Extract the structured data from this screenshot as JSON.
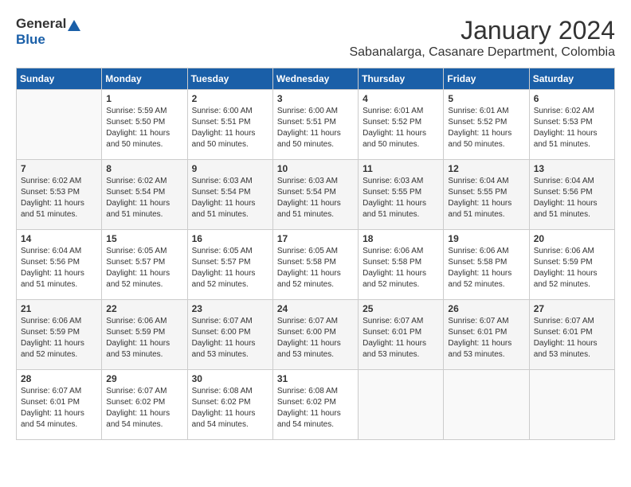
{
  "header": {
    "logo_general": "General",
    "logo_blue": "Blue",
    "title": "January 2024",
    "subtitle": "Sabanalarga, Casanare Department, Colombia"
  },
  "weekdays": [
    "Sunday",
    "Monday",
    "Tuesday",
    "Wednesday",
    "Thursday",
    "Friday",
    "Saturday"
  ],
  "weeks": [
    [
      {
        "day": "",
        "sunrise": "",
        "sunset": "",
        "daylight": ""
      },
      {
        "day": "1",
        "sunrise": "Sunrise: 5:59 AM",
        "sunset": "Sunset: 5:50 PM",
        "daylight": "Daylight: 11 hours and 50 minutes."
      },
      {
        "day": "2",
        "sunrise": "Sunrise: 6:00 AM",
        "sunset": "Sunset: 5:51 PM",
        "daylight": "Daylight: 11 hours and 50 minutes."
      },
      {
        "day": "3",
        "sunrise": "Sunrise: 6:00 AM",
        "sunset": "Sunset: 5:51 PM",
        "daylight": "Daylight: 11 hours and 50 minutes."
      },
      {
        "day": "4",
        "sunrise": "Sunrise: 6:01 AM",
        "sunset": "Sunset: 5:52 PM",
        "daylight": "Daylight: 11 hours and 50 minutes."
      },
      {
        "day": "5",
        "sunrise": "Sunrise: 6:01 AM",
        "sunset": "Sunset: 5:52 PM",
        "daylight": "Daylight: 11 hours and 50 minutes."
      },
      {
        "day": "6",
        "sunrise": "Sunrise: 6:02 AM",
        "sunset": "Sunset: 5:53 PM",
        "daylight": "Daylight: 11 hours and 51 minutes."
      }
    ],
    [
      {
        "day": "7",
        "sunrise": "Sunrise: 6:02 AM",
        "sunset": "Sunset: 5:53 PM",
        "daylight": "Daylight: 11 hours and 51 minutes."
      },
      {
        "day": "8",
        "sunrise": "Sunrise: 6:02 AM",
        "sunset": "Sunset: 5:54 PM",
        "daylight": "Daylight: 11 hours and 51 minutes."
      },
      {
        "day": "9",
        "sunrise": "Sunrise: 6:03 AM",
        "sunset": "Sunset: 5:54 PM",
        "daylight": "Daylight: 11 hours and 51 minutes."
      },
      {
        "day": "10",
        "sunrise": "Sunrise: 6:03 AM",
        "sunset": "Sunset: 5:54 PM",
        "daylight": "Daylight: 11 hours and 51 minutes."
      },
      {
        "day": "11",
        "sunrise": "Sunrise: 6:03 AM",
        "sunset": "Sunset: 5:55 PM",
        "daylight": "Daylight: 11 hours and 51 minutes."
      },
      {
        "day": "12",
        "sunrise": "Sunrise: 6:04 AM",
        "sunset": "Sunset: 5:55 PM",
        "daylight": "Daylight: 11 hours and 51 minutes."
      },
      {
        "day": "13",
        "sunrise": "Sunrise: 6:04 AM",
        "sunset": "Sunset: 5:56 PM",
        "daylight": "Daylight: 11 hours and 51 minutes."
      }
    ],
    [
      {
        "day": "14",
        "sunrise": "Sunrise: 6:04 AM",
        "sunset": "Sunset: 5:56 PM",
        "daylight": "Daylight: 11 hours and 51 minutes."
      },
      {
        "day": "15",
        "sunrise": "Sunrise: 6:05 AM",
        "sunset": "Sunset: 5:57 PM",
        "daylight": "Daylight: 11 hours and 52 minutes."
      },
      {
        "day": "16",
        "sunrise": "Sunrise: 6:05 AM",
        "sunset": "Sunset: 5:57 PM",
        "daylight": "Daylight: 11 hours and 52 minutes."
      },
      {
        "day": "17",
        "sunrise": "Sunrise: 6:05 AM",
        "sunset": "Sunset: 5:58 PM",
        "daylight": "Daylight: 11 hours and 52 minutes."
      },
      {
        "day": "18",
        "sunrise": "Sunrise: 6:06 AM",
        "sunset": "Sunset: 5:58 PM",
        "daylight": "Daylight: 11 hours and 52 minutes."
      },
      {
        "day": "19",
        "sunrise": "Sunrise: 6:06 AM",
        "sunset": "Sunset: 5:58 PM",
        "daylight": "Daylight: 11 hours and 52 minutes."
      },
      {
        "day": "20",
        "sunrise": "Sunrise: 6:06 AM",
        "sunset": "Sunset: 5:59 PM",
        "daylight": "Daylight: 11 hours and 52 minutes."
      }
    ],
    [
      {
        "day": "21",
        "sunrise": "Sunrise: 6:06 AM",
        "sunset": "Sunset: 5:59 PM",
        "daylight": "Daylight: 11 hours and 52 minutes."
      },
      {
        "day": "22",
        "sunrise": "Sunrise: 6:06 AM",
        "sunset": "Sunset: 5:59 PM",
        "daylight": "Daylight: 11 hours and 53 minutes."
      },
      {
        "day": "23",
        "sunrise": "Sunrise: 6:07 AM",
        "sunset": "Sunset: 6:00 PM",
        "daylight": "Daylight: 11 hours and 53 minutes."
      },
      {
        "day": "24",
        "sunrise": "Sunrise: 6:07 AM",
        "sunset": "Sunset: 6:00 PM",
        "daylight": "Daylight: 11 hours and 53 minutes."
      },
      {
        "day": "25",
        "sunrise": "Sunrise: 6:07 AM",
        "sunset": "Sunset: 6:01 PM",
        "daylight": "Daylight: 11 hours and 53 minutes."
      },
      {
        "day": "26",
        "sunrise": "Sunrise: 6:07 AM",
        "sunset": "Sunset: 6:01 PM",
        "daylight": "Daylight: 11 hours and 53 minutes."
      },
      {
        "day": "27",
        "sunrise": "Sunrise: 6:07 AM",
        "sunset": "Sunset: 6:01 PM",
        "daylight": "Daylight: 11 hours and 53 minutes."
      }
    ],
    [
      {
        "day": "28",
        "sunrise": "Sunrise: 6:07 AM",
        "sunset": "Sunset: 6:01 PM",
        "daylight": "Daylight: 11 hours and 54 minutes."
      },
      {
        "day": "29",
        "sunrise": "Sunrise: 6:07 AM",
        "sunset": "Sunset: 6:02 PM",
        "daylight": "Daylight: 11 hours and 54 minutes."
      },
      {
        "day": "30",
        "sunrise": "Sunrise: 6:08 AM",
        "sunset": "Sunset: 6:02 PM",
        "daylight": "Daylight: 11 hours and 54 minutes."
      },
      {
        "day": "31",
        "sunrise": "Sunrise: 6:08 AM",
        "sunset": "Sunset: 6:02 PM",
        "daylight": "Daylight: 11 hours and 54 minutes."
      },
      {
        "day": "",
        "sunrise": "",
        "sunset": "",
        "daylight": ""
      },
      {
        "day": "",
        "sunrise": "",
        "sunset": "",
        "daylight": ""
      },
      {
        "day": "",
        "sunrise": "",
        "sunset": "",
        "daylight": ""
      }
    ]
  ]
}
